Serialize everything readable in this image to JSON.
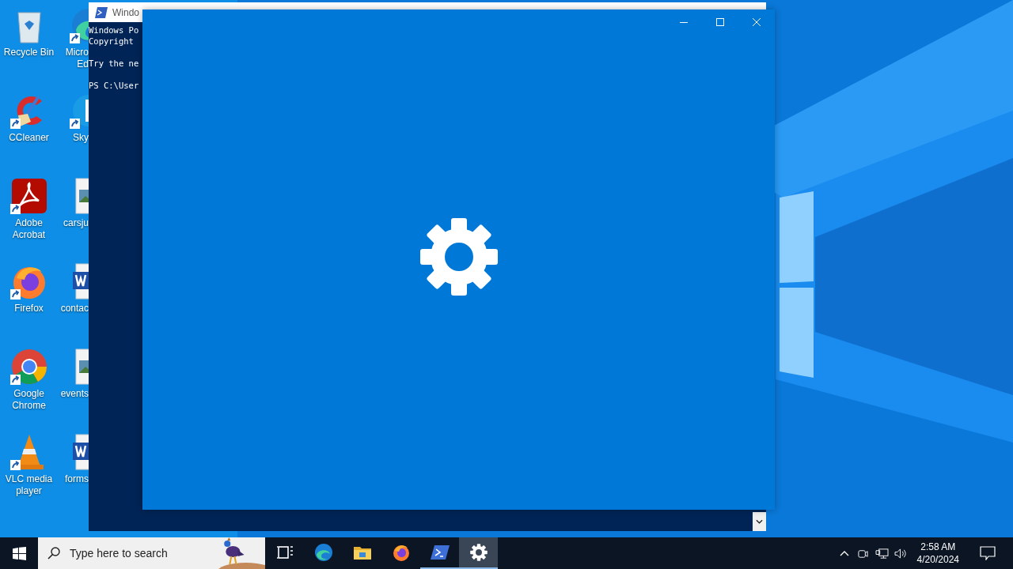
{
  "desktop": {
    "icons": [
      {
        "label": "Recycle Bin",
        "kind": "recycle-bin",
        "shortcut": false
      },
      {
        "label": "CCleaner",
        "kind": "ccleaner",
        "shortcut": true
      },
      {
        "label": "Adobe Acrobat",
        "kind": "acrobat",
        "shortcut": true
      },
      {
        "label": "Firefox",
        "kind": "firefox",
        "shortcut": true
      },
      {
        "label": "Google Chrome",
        "kind": "chrome",
        "shortcut": true
      },
      {
        "label": "VLC media player",
        "kind": "vlc",
        "shortcut": true
      }
    ],
    "icons_column_2": [
      {
        "label": "Micro Ed",
        "kind": "edge",
        "shortcut": true
      },
      {
        "label": "Sky",
        "kind": "skype",
        "shortcut": true
      },
      {
        "label": "carsju",
        "kind": "image-file",
        "shortcut": false
      },
      {
        "label": "contac",
        "kind": "word-doc",
        "shortcut": false
      },
      {
        "label": "events",
        "kind": "image-file",
        "shortcut": false
      },
      {
        "label": "forms",
        "kind": "word-doc",
        "shortcut": false
      }
    ]
  },
  "powershell_window": {
    "title": "Windo",
    "lines": [
      {
        "text": "Windows Po",
        "blank_before": false
      },
      {
        "text": "Copyright",
        "blank_before": false
      },
      {
        "text": "Try the ne",
        "blank_before": true
      },
      {
        "text": "PS C:\\User",
        "blank_before": true
      }
    ]
  },
  "taskbar": {
    "search": {
      "placeholder": "Type here to search"
    },
    "apps": [
      {
        "kind": "task-view",
        "running": false,
        "selected": false
      },
      {
        "kind": "edge",
        "running": false,
        "selected": false
      },
      {
        "kind": "explorer",
        "running": false,
        "selected": false
      },
      {
        "kind": "firefox",
        "running": false,
        "selected": false
      },
      {
        "kind": "powershell",
        "running": true,
        "selected": false
      },
      {
        "kind": "settings",
        "running": true,
        "selected": true
      }
    ],
    "clock": {
      "time": "2:58 AM",
      "date": "4/20/2024"
    }
  }
}
